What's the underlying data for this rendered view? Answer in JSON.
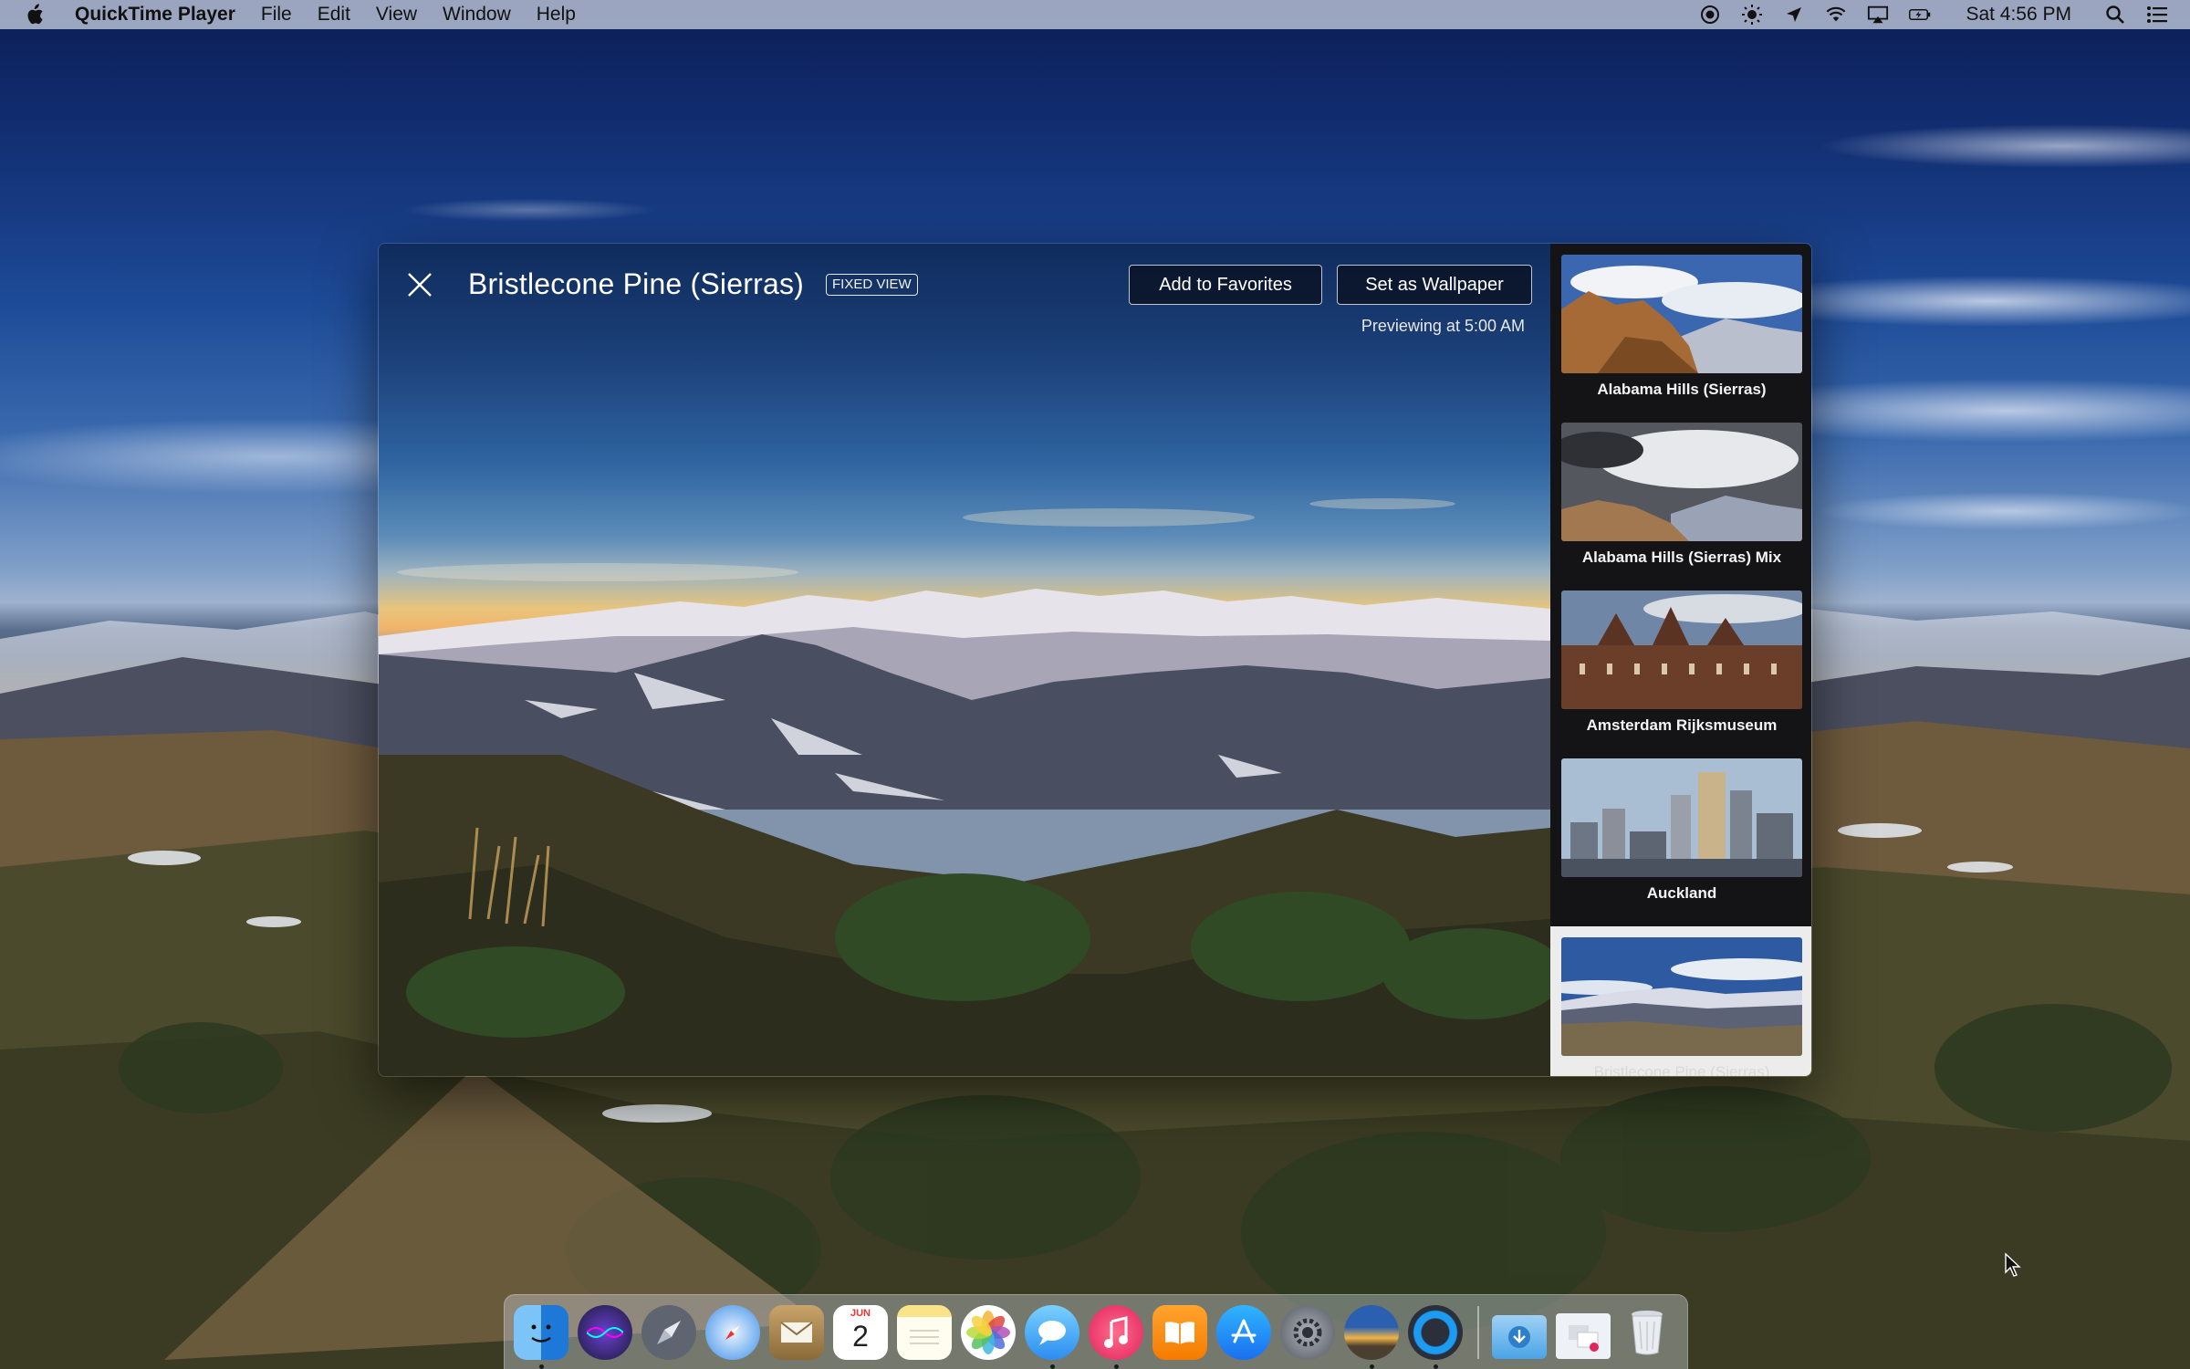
{
  "menubar": {
    "app_name": "QuickTime Player",
    "menus": [
      "File",
      "Edit",
      "View",
      "Window",
      "Help"
    ],
    "status_icons": [
      "screen-record-icon",
      "brightness-icon",
      "location-icon",
      "wifi-icon",
      "airplay-icon",
      "battery-icon"
    ],
    "clock": "Sat 4:56 PM"
  },
  "preview": {
    "title": "Bristlecone Pine (Sierras)",
    "badge": "FIXED VIEW",
    "add_favorites": "Add to Favorites",
    "set_wallpaper": "Set as Wallpaper",
    "previewing": "Previewing at 5:00 AM"
  },
  "sidebar": {
    "items": [
      {
        "label": "Alabama Hills (Sierras)",
        "selected": false
      },
      {
        "label": "Alabama Hills (Sierras) Mix",
        "selected": false
      },
      {
        "label": "Amsterdam Rijksmuseum",
        "selected": false
      },
      {
        "label": "Auckland",
        "selected": false
      },
      {
        "label": "Bristlecone Pine (Sierras)",
        "selected": true
      }
    ]
  },
  "dock": {
    "apps": [
      "finder-icon",
      "siri-icon",
      "launchpad-icon",
      "safari-icon",
      "mail-icon",
      "calendar-icon",
      "notes-icon",
      "photos-icon",
      "messages-icon",
      "music-icon",
      "books-icon",
      "app-store-icon",
      "system-preferences-icon",
      "aerial-icon",
      "quicktime-icon"
    ],
    "calendar_month": "JUN",
    "calendar_day": "2",
    "others": [
      "downloads-folder-icon",
      "documents-stack-icon",
      "trash-icon"
    ]
  },
  "colors": {
    "menubar_bg": "#c4ccdc",
    "sidebar_bg": "#141417",
    "selected_item_bg": "#ececec"
  }
}
